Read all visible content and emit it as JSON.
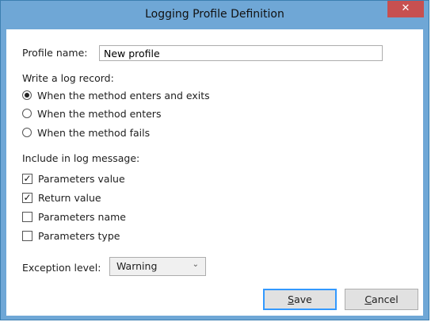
{
  "window": {
    "title": "Logging Profile Definition",
    "close_glyph": "✕"
  },
  "profile": {
    "label": "Profile name:",
    "value": "New profile"
  },
  "log_record": {
    "label": "Write a log record:",
    "options": [
      {
        "label": "When the method enters and exits",
        "selected": true
      },
      {
        "label": "When the method enters",
        "selected": false
      },
      {
        "label": "When the method fails",
        "selected": false
      }
    ]
  },
  "include": {
    "label": "Include in log message:",
    "options": [
      {
        "label": "Parameters value",
        "checked": true,
        "mark": "✓"
      },
      {
        "label": "Return value",
        "checked": true,
        "mark": "✓"
      },
      {
        "label": "Parameters name",
        "checked": false,
        "mark": ""
      },
      {
        "label": "Parameters type",
        "checked": false,
        "mark": ""
      }
    ]
  },
  "exception": {
    "label": "Exception level:",
    "value": "Warning",
    "arrow": "⌄"
  },
  "buttons": {
    "save": {
      "first": "S",
      "rest": "ave"
    },
    "cancel": {
      "first": "C",
      "rest": "ancel"
    }
  }
}
